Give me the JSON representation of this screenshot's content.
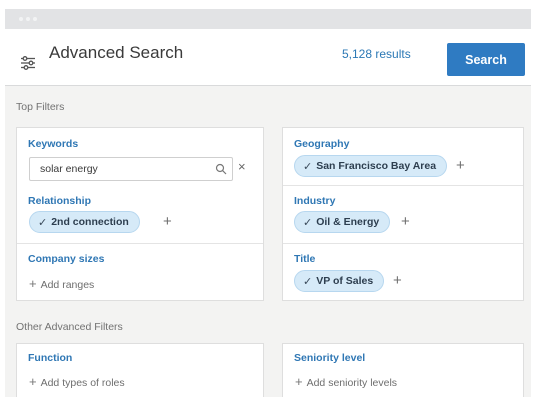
{
  "header": {
    "title": "Advanced Search",
    "results": "5,128 results",
    "search_label": "Search"
  },
  "sections": {
    "top_filters": "Top Filters",
    "other_filters": "Other Advanced Filters"
  },
  "filters": {
    "keywords": {
      "label": "Keywords",
      "value": "solar energy",
      "clear": "×"
    },
    "relationship": {
      "label": "Relationship",
      "chip": "2nd connection"
    },
    "company_sizes": {
      "label": "Company sizes",
      "add": "Add ranges"
    },
    "geography": {
      "label": "Geography",
      "chip": "San Francisco Bay Area"
    },
    "industry": {
      "label": "Industry",
      "chip": "Oil & Energy"
    },
    "title": {
      "label": "Title",
      "chip": "VP of Sales"
    },
    "function": {
      "label": "Function",
      "add": "Add types of roles"
    },
    "seniority": {
      "label": "Seniority level",
      "add": "Add seniority levels"
    }
  },
  "glyphs": {
    "check": "✓",
    "plus": "+"
  },
  "colors": {
    "accent": "#2f7bc2",
    "link": "#2f77b4",
    "chip_bg": "#d6eaf8",
    "page_bg": "#f3f3f2"
  },
  "icons": {
    "filter": "filter-lines-icon",
    "search": "magnifier-icon",
    "clear": "close-icon",
    "check": "check-icon",
    "add": "plus-icon"
  }
}
